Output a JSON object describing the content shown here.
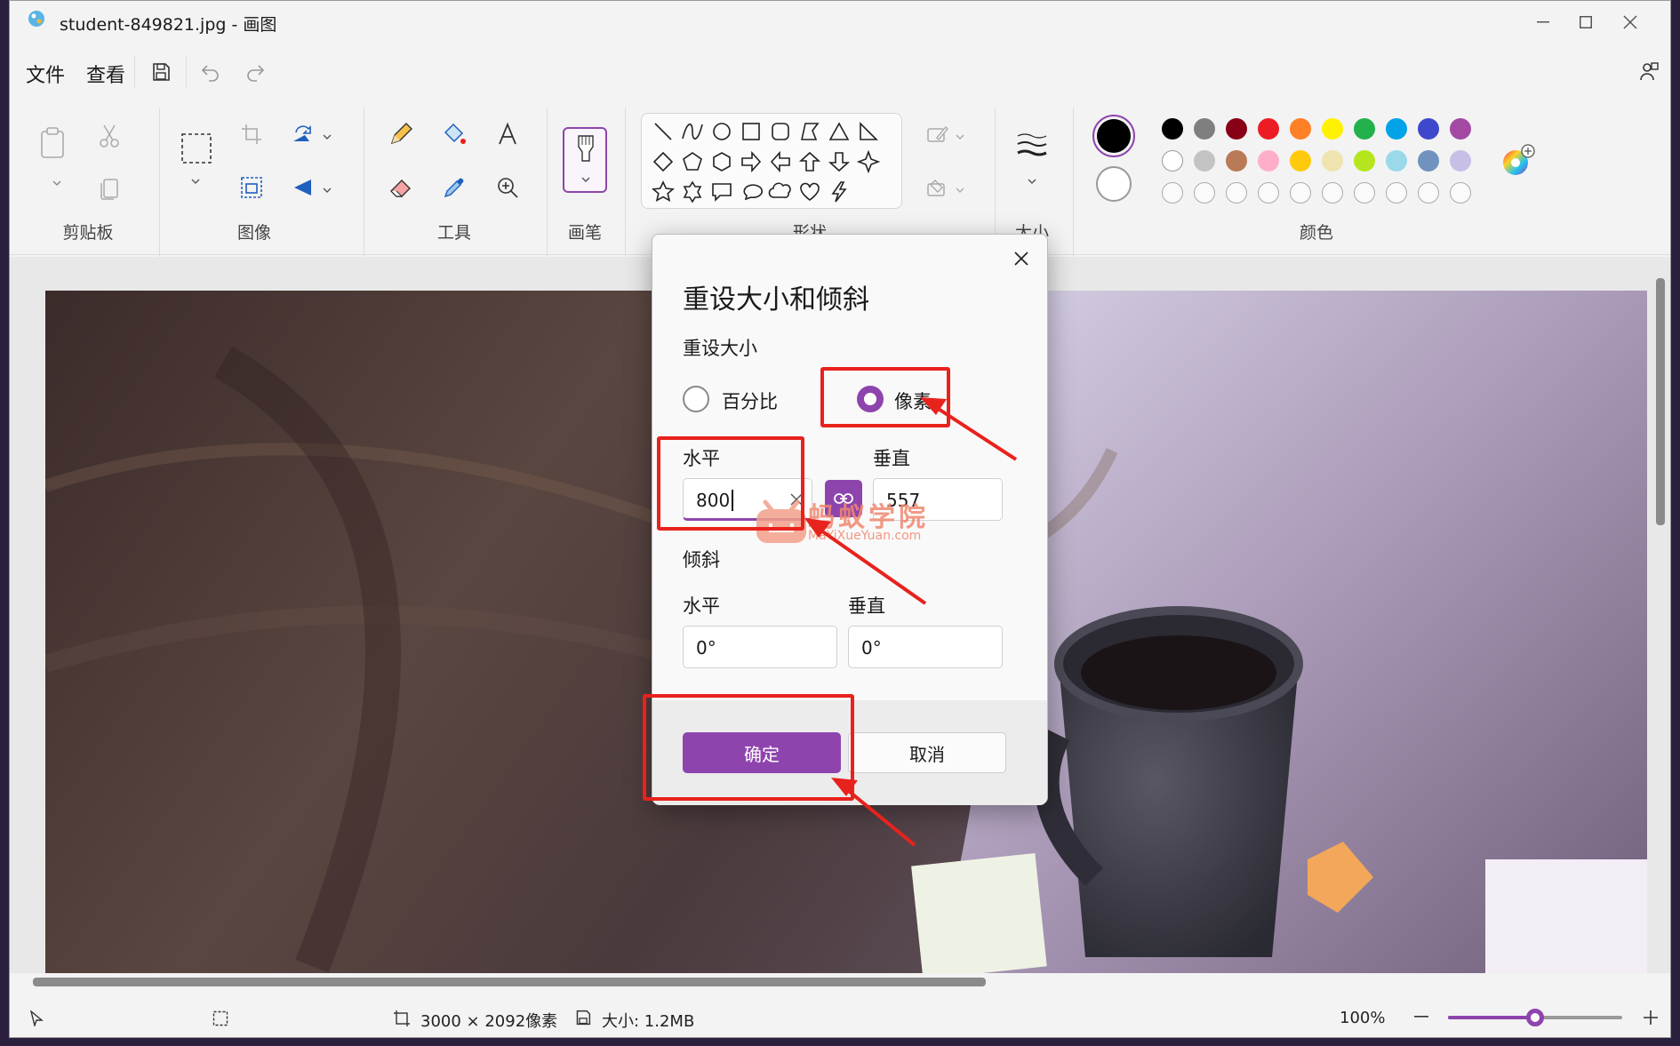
{
  "window": {
    "title": "student-849821.jpg - 画图"
  },
  "menu": {
    "file": "文件",
    "view": "查看"
  },
  "ribbon": {
    "groups": {
      "clipboard": "剪贴板",
      "image": "图像",
      "tools": "工具",
      "brush": "画笔",
      "shapes": "形状",
      "size": "大小",
      "colors": "颜色"
    },
    "palette_row1": [
      "#000000",
      "#7f7f7f",
      "#880015",
      "#ed1c24",
      "#ff7f27",
      "#fff200",
      "#22b14c",
      "#00a2e8",
      "#3f48cc",
      "#a349a4"
    ],
    "palette_row2": [
      "#ffffff",
      "#c3c3c3",
      "#b97a57",
      "#ffaec9",
      "#ffc90e",
      "#efe4b0",
      "#b5e61d",
      "#99d9ea",
      "#7092be",
      "#c8bfe7"
    ],
    "primary_color": "#000000",
    "secondary_color": "#ffffff"
  },
  "dialog": {
    "title": "重设大小和倾斜",
    "resize_heading": "重设大小",
    "option_percent": "百分比",
    "option_pixels": "像素",
    "selected_option": "pixels",
    "horizontal_label": "水平",
    "vertical_label": "垂直",
    "resize_horizontal_value": "800",
    "resize_vertical_value": "557",
    "skew_heading": "倾斜",
    "skew_horizontal_label": "水平",
    "skew_vertical_label": "垂直",
    "skew_horizontal_value": "0°",
    "skew_vertical_value": "0°",
    "ok": "确定",
    "cancel": "取消"
  },
  "status": {
    "dimensions": "3000 × 2092像素",
    "size": "大小: 1.2MB",
    "zoom": "100%",
    "zoom_fraction": 0.5
  },
  "watermark": {
    "name": "蚂蚁学院",
    "url": "MaYiXueYuan.com"
  },
  "theme": {
    "accent": "#8e44ad",
    "annotation": "#e8221c"
  }
}
